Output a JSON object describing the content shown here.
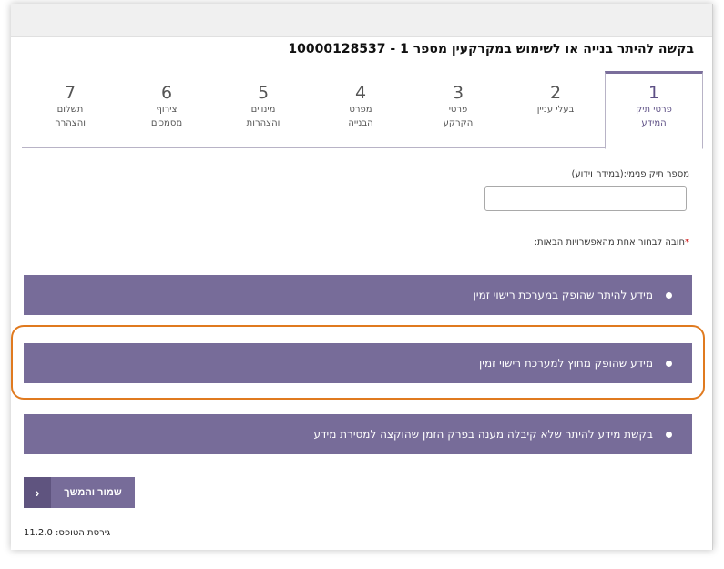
{
  "title": "בקשה להיתר בנייה או לשימוש במקרקעין מספר 1 - 10000128537",
  "tabs": [
    {
      "num": "1",
      "line1": "פרטי תיק",
      "line2": "המידע"
    },
    {
      "num": "2",
      "line1": "בעלי עניין",
      "line2": ""
    },
    {
      "num": "3",
      "line1": "פרטי",
      "line2": "הקרקע"
    },
    {
      "num": "4",
      "line1": "מפרט",
      "line2": "הבנייה"
    },
    {
      "num": "5",
      "line1": "מינויים",
      "line2": "והצהרות"
    },
    {
      "num": "6",
      "line1": "צירוף",
      "line2": "מסמכים"
    },
    {
      "num": "7",
      "line1": "תשלום",
      "line2": "והצהרה"
    }
  ],
  "file_number": {
    "label": "מספר תיק פנימי:(במידה וידוע)",
    "value": ""
  },
  "required_note": {
    "star": "*",
    "text": "חובה לבחור אחת מהאפשרויות הבאות:"
  },
  "options": [
    "מידע להיתר שהופק במערכת רישוי זמין",
    "מידע שהופק מחוץ למערכת רישוי זמין",
    "בקשת מידע להיתר שלא קיבלה מענה בפרק הזמן שהוקצה למסירת מידע"
  ],
  "save_button": {
    "label": "שמור והמשך",
    "chevron": "‹"
  },
  "version_text": "גירסת הטופס: 11.2.0",
  "colors": {
    "accent": "#776c99",
    "highlight": "#e07a1f"
  }
}
